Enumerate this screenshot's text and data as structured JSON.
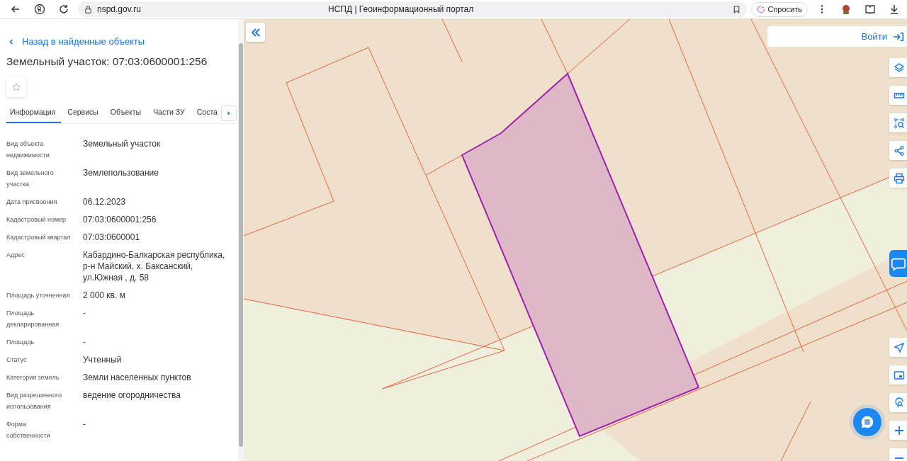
{
  "browser": {
    "url": "nspd.gov.ru",
    "title": "НСПД | Геоинформационный портал",
    "ask_button": "Спросить"
  },
  "sidebar": {
    "back_link": "Назад в найденные объекты",
    "title": "Земельный участок: 07:03:0600001:256",
    "tabs": [
      {
        "label": "Информация",
        "selected": true
      },
      {
        "label": "Сервисы",
        "selected": false
      },
      {
        "label": "Объекты",
        "selected": false
      },
      {
        "label": "Части ЗУ",
        "selected": false
      },
      {
        "label": "Соста",
        "selected": false
      }
    ],
    "properties": [
      {
        "label": "Вид объекта недвижимости",
        "value": "Земельный участок"
      },
      {
        "label": "Вид земельного участка",
        "value": "Землепользование"
      },
      {
        "label": "Дата присвоения",
        "value": "06.12.2023"
      },
      {
        "label": "Кадастровый номер",
        "value": "07:03:0600001:256"
      },
      {
        "label": "Кадастровый квартал",
        "value": "07:03:0600001"
      },
      {
        "label": "Адрес",
        "value": "Кабардино-Балкарская республика, р-н Майский, х. Баксанский, ул.Южная , д. 58"
      },
      {
        "label": "Площадь уточненная",
        "value": "2 000 кв. м"
      },
      {
        "label": "Площадь декларированная",
        "value": "-"
      },
      {
        "label": "Площадь",
        "value": "-"
      },
      {
        "label": "Статус",
        "value": "Учтенный"
      },
      {
        "label": "Категория земель",
        "value": "Земли населенных пунктов"
      },
      {
        "label": "Вид разрешенного использования",
        "value": "ведение огородничества"
      },
      {
        "label": "Форма собственности",
        "value": "-"
      }
    ]
  },
  "map": {
    "login_button": "Войти"
  }
}
